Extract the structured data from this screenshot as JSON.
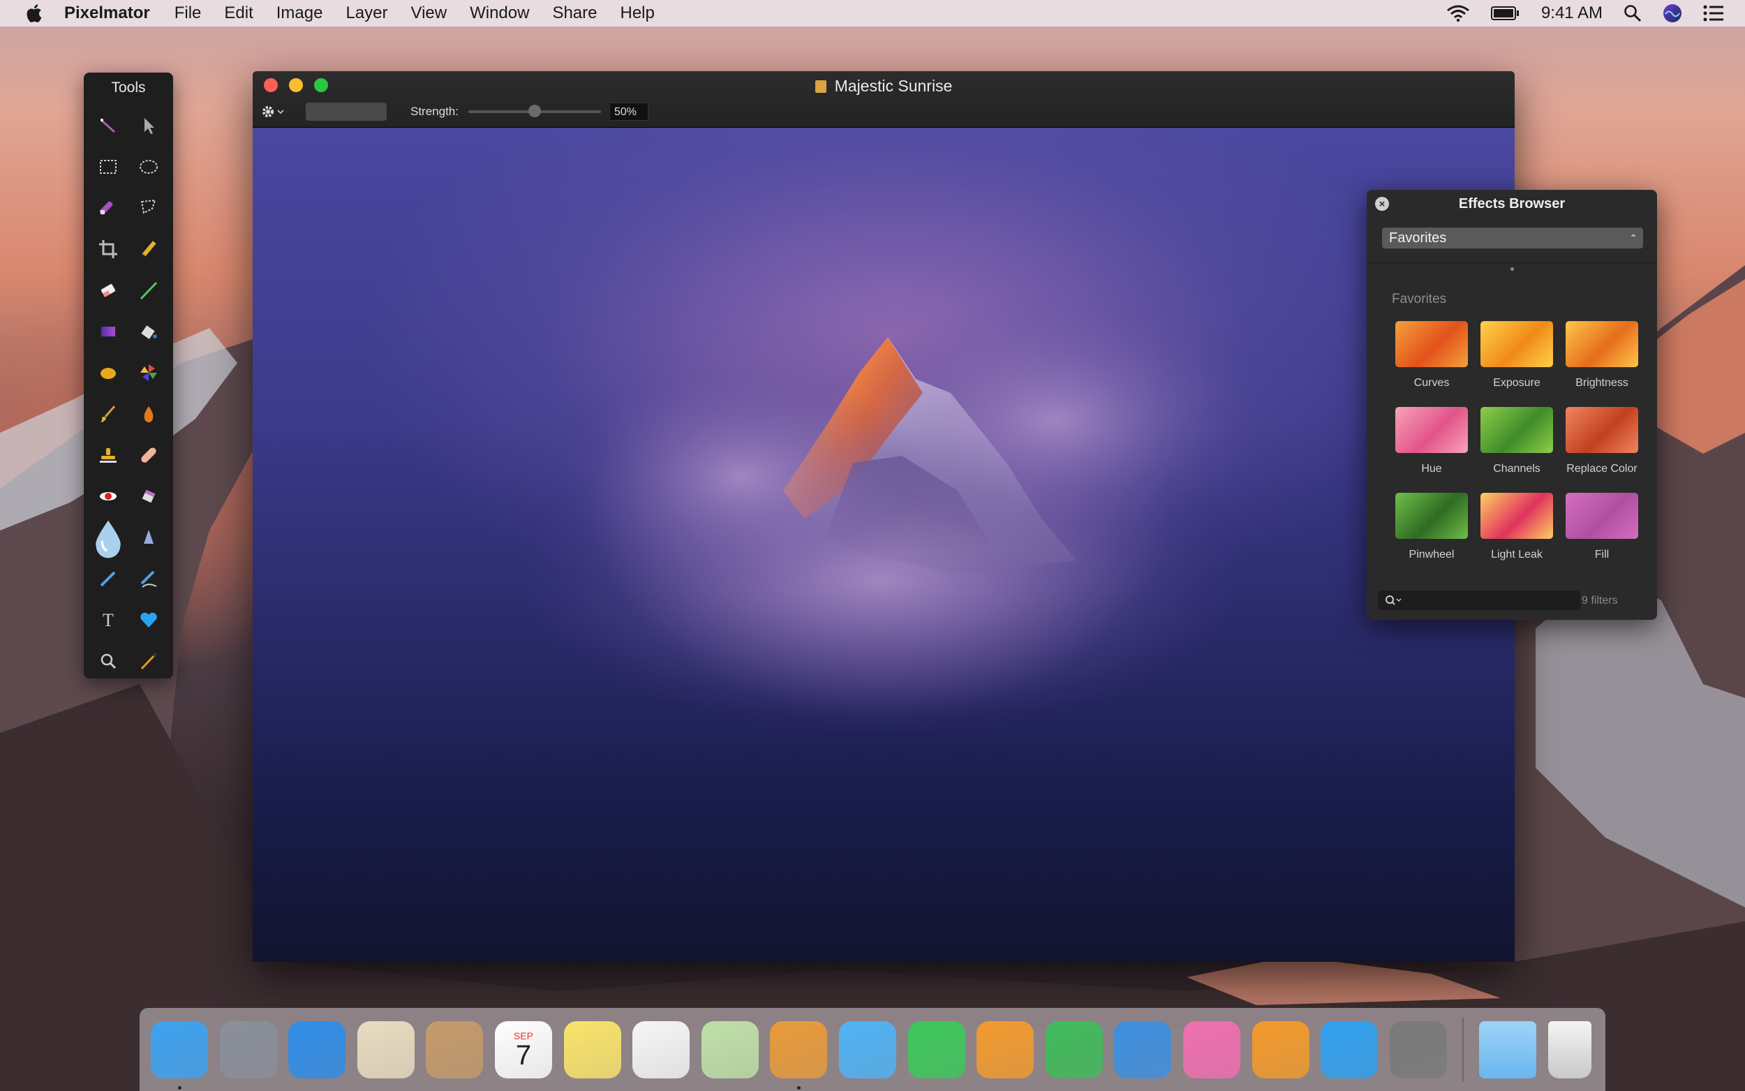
{
  "menubar": {
    "app_name": "Pixelmator",
    "menus": [
      "File",
      "Edit",
      "Image",
      "Layer",
      "View",
      "Window",
      "Share",
      "Help"
    ],
    "clock": "9:41 AM",
    "status_icons": [
      "wifi-icon",
      "battery-icon",
      "spotlight-icon",
      "siri-icon",
      "notification-center-icon"
    ]
  },
  "tools_palette": {
    "title": "Tools",
    "tools": [
      "magic-wand-icon",
      "move-arrow-icon",
      "rect-select-icon",
      "ellipse-select-icon",
      "quick-select-icon",
      "lasso-icon",
      "crop-icon",
      "pencil-icon",
      "eraser-icon",
      "brush-line-icon",
      "gradient-icon",
      "paint-bucket-icon",
      "color-fill-icon",
      "pinwheel-icon",
      "smudge-icon",
      "burn-drop-icon",
      "clone-stamp-icon",
      "healing-bandage-icon",
      "red-eye-icon",
      "sponge-icon",
      "water-drop-icon",
      "sharpen-icon",
      "pen-icon",
      "freeform-pen-icon",
      "type-icon",
      "heart-shape-icon",
      "zoom-icon",
      "eyedropper-icon"
    ]
  },
  "document": {
    "title": "Majestic Sunrise",
    "strength_label": "Strength:",
    "strength_value": "50%",
    "strength_fraction": 0.5
  },
  "effects_browser": {
    "title": "Effects Browser",
    "category": "Favorites",
    "section_label": "Favorites",
    "filters": [
      {
        "name": "Curves",
        "colors": [
          "#f6a03a",
          "#e2521c"
        ]
      },
      {
        "name": "Exposure",
        "colors": [
          "#ffd24a",
          "#f08a18"
        ]
      },
      {
        "name": "Brightness",
        "colors": [
          "#ffc64a",
          "#e66d1a"
        ]
      },
      {
        "name": "Hue",
        "colors": [
          "#f7a3b8",
          "#e2548a"
        ]
      },
      {
        "name": "Channels",
        "colors": [
          "#8fce4a",
          "#3f8c2a"
        ]
      },
      {
        "name": "Replace Color",
        "colors": [
          "#f08560",
          "#c2401e"
        ]
      },
      {
        "name": "Pinwheel",
        "colors": [
          "#6fbf4a",
          "#2f6b22"
        ]
      },
      {
        "name": "Light Leak",
        "colors": [
          "#ffd060",
          "#e0325e"
        ]
      },
      {
        "name": "Fill",
        "colors": [
          "#d56fc0",
          "#b04fa0"
        ]
      }
    ],
    "filter_count": "9 filters"
  },
  "dock": {
    "apps": [
      {
        "name": "finder-icon",
        "color": "#3da2f0",
        "running": true
      },
      {
        "name": "launchpad-icon",
        "color": "#8a8f99",
        "running": false
      },
      {
        "name": "safari-icon",
        "color": "#2f8de8",
        "running": false
      },
      {
        "name": "mail-icon",
        "color": "#e8dcc0",
        "running": false
      },
      {
        "name": "contacts-icon",
        "color": "#c49a6a",
        "running": false
      },
      {
        "name": "calendar-icon",
        "color": "#ffffff",
        "running": false
      },
      {
        "name": "notes-icon",
        "color": "#f9e46b",
        "running": false
      },
      {
        "name": "reminders-icon",
        "color": "#f6f6f6",
        "running": false
      },
      {
        "name": "maps-icon",
        "color": "#bfe0a8",
        "running": false
      },
      {
        "name": "pixelmator-icon",
        "color": "#e89a3a",
        "running": true
      },
      {
        "name": "messages-icon",
        "color": "#4fb3f5",
        "running": false
      },
      {
        "name": "facetime-icon",
        "color": "#3cc85a",
        "running": false
      },
      {
        "name": "pages-icon",
        "color": "#f29a2e",
        "running": false
      },
      {
        "name": "numbers-icon",
        "color": "#3fbb5a",
        "running": false
      },
      {
        "name": "keynote-icon",
        "color": "#3d8fe0",
        "running": false
      },
      {
        "name": "itunes-icon",
        "color": "#f06fb0",
        "running": false
      },
      {
        "name": "ibooks-icon",
        "color": "#f39a2a",
        "running": false
      },
      {
        "name": "app-store-icon",
        "color": "#2ea0f0",
        "running": false
      },
      {
        "name": "system-preferences-icon",
        "color": "#7a7a7a",
        "running": false
      }
    ],
    "calendar_month": "SEP",
    "calendar_day": "7",
    "stack_folder": "downloads-folder-icon",
    "trash": "trash-icon"
  }
}
